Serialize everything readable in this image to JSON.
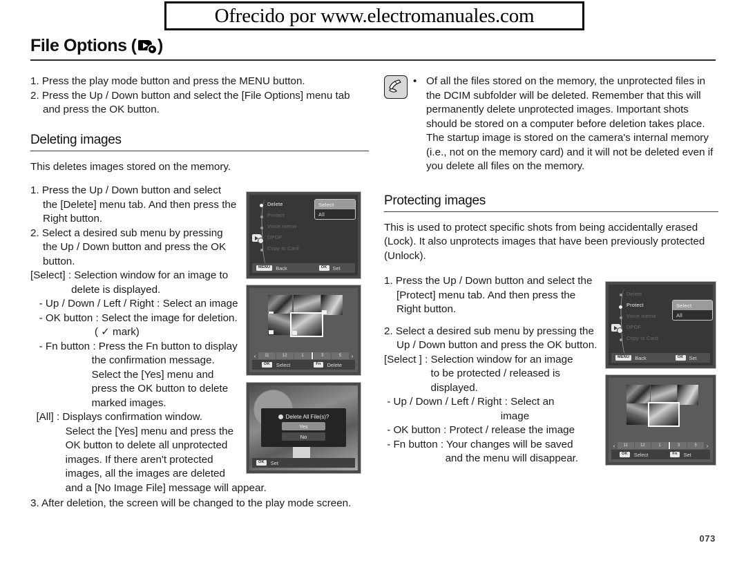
{
  "watermark": {
    "text": "Ofrecido por www.electromanuales.com"
  },
  "heading": {
    "title": "File Options",
    "paren_open": "(",
    "paren_close": ")",
    "icon": "file-options-gear-icon"
  },
  "left_column": {
    "intro_steps": [
      "1. Press the play mode button and press the MENU button.",
      "2. Press the Up / Down button and select the [File Options] menu tab and press the OK button."
    ],
    "section": {
      "title": "Deleting images",
      "lead": "This deletes images stored on the memory.",
      "steps": [
        "1. Press the Up / Down button and select the [Delete] menu tab. And then press the Right button.",
        "2. Select a desired sub menu by pressing the Up / Down button and press the OK button."
      ],
      "detail_lines": [
        "[Select] : Selection window for an image to",
        "              delete is displayed.",
        "   - Up / Down / Left / Right : Select an image",
        "   - OK button : Select the image for deletion.",
        "                      ( ✓ mark)",
        "   - Fn button : Press the Fn button to display",
        "                     the confirmation message.",
        "                     Select the [Yes] menu and",
        "                     press the OK button to delete",
        "                     marked images.",
        "  [All] : Displays confirmation window.",
        "            Select the [Yes] menu and press the",
        "            OK button to delete all unprotected",
        "            images. If there aren't protected",
        "            images, all the images are deleted",
        "            and a [No Image File] message will appear."
      ],
      "final_step": "3. After deletion, the screen will be changed to the play mode screen."
    }
  },
  "right_column": {
    "note": {
      "icon": "note-pen-icon",
      "bullet": "•",
      "text": "Of all the files stored on the memory, the unprotected files in the DCIM subfolder will be deleted. Remember that this will permanently delete unprotected images. Important shots should be stored on a computer before deletion takes place. The startup image is stored on the camera's internal memory (i.e., not on the memory card) and it will not be deleted even if you delete all files on the memory."
    },
    "section": {
      "title": "Protecting images",
      "lead": "This is used to protect specific shots from being accidentally erased (Lock). It also unprotects images that have been previously protected (Unlock).",
      "steps": [
        "1. Press the Up / Down button and select the [Protect] menu tab. And then press the Right button.",
        "2. Select a desired sub menu by pressing the Up / Down button and press the OK button."
      ],
      "detail_lines": [
        "[Select ] : Selection window for an image",
        "                to be protected / released is",
        "                displayed.",
        " - Up / Down / Left / Right : Select an",
        "                                        image",
        " - OK button : Protect / release the image",
        " - Fn button : Your changes will be saved",
        "                     and the menu will disappear."
      ]
    }
  },
  "lcd_menu_delete": {
    "name": "delete-menu-screen",
    "tab_icon": "file-options-tab-icon",
    "items": [
      {
        "label": "Delete",
        "active": true
      },
      {
        "label": "Protect",
        "active": false
      },
      {
        "label": "Voice memo",
        "active": false
      },
      {
        "label": "DPOF",
        "active": false
      },
      {
        "label": "Copy to Card",
        "active": false
      }
    ],
    "submenu": [
      {
        "label": "Select",
        "selected": true
      },
      {
        "label": "All",
        "selected": false
      }
    ],
    "bottom_bar": {
      "left_key": "MENU",
      "left_label": "Back",
      "right_key": "OK",
      "right_label": "Set"
    }
  },
  "lcd_menu_protect": {
    "name": "protect-menu-screen",
    "tab_icon": "file-options-tab-icon",
    "items": [
      {
        "label": "Delete",
        "active": false
      },
      {
        "label": "Protect",
        "active": true
      },
      {
        "label": "Voice memo",
        "active": false
      },
      {
        "label": "DPOF",
        "active": false
      },
      {
        "label": "Copy to Card",
        "active": false
      }
    ],
    "submenu": [
      {
        "label": "Select",
        "selected": true
      },
      {
        "label": "All",
        "selected": false
      }
    ],
    "bottom_bar": {
      "left_key": "MENU",
      "left_label": "Back",
      "right_key": "OK",
      "right_label": "Set"
    }
  },
  "lcd_thumbnails_delete": {
    "name": "thumbnail-select-delete-screen",
    "page_numbers": [
      "11",
      "12",
      "1",
      "3",
      "5"
    ],
    "left_arrow": "‹",
    "right_arrow": "›",
    "bottom_bar": {
      "left_key": "OK",
      "left_label": "Select",
      "right_key": "Fn",
      "right_label": "Delete"
    }
  },
  "lcd_thumbnails_protect": {
    "name": "thumbnail-select-protect-screen",
    "page_numbers": [
      "11",
      "12",
      "1",
      "3",
      "5"
    ],
    "left_arrow": "‹",
    "right_arrow": "›",
    "bottom_bar": {
      "left_key": "OK",
      "left_label": "Select",
      "right_key": "Fn",
      "right_label": "Set"
    }
  },
  "lcd_confirm_delete": {
    "name": "delete-all-confirm-screen",
    "title": "Delete All File(s)?",
    "buttons": [
      {
        "label": "Yes",
        "selected": true
      },
      {
        "label": "No",
        "selected": false
      }
    ],
    "bottom_bar": {
      "left_key": "OK",
      "left_label": "Set"
    }
  },
  "footer": {
    "page_number": "073"
  },
  "colors": {
    "text": "#1b1b1b",
    "rule": "#2a2a2a",
    "lcd_bg": "#3c3c3c",
    "lcd_highlight": "#9b9b9b",
    "page_number": "#3a3a3a"
  }
}
